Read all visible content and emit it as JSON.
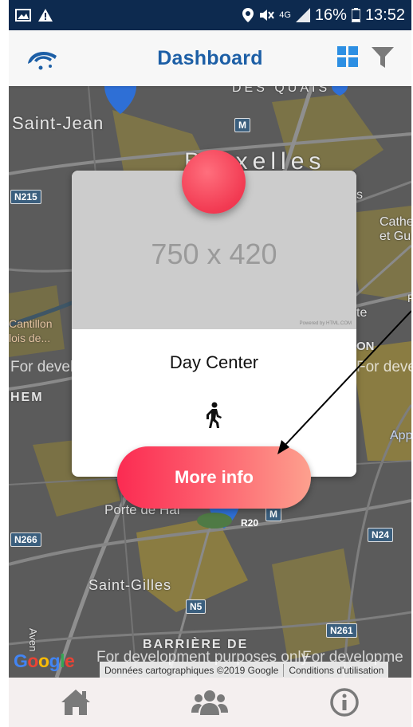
{
  "status_bar": {
    "network": "4G",
    "battery": "16%",
    "time": "13:52"
  },
  "header": {
    "title": "Dashboard",
    "logo_icon": "umbrella-logo-icon",
    "grid_icon": "grid-view-icon",
    "filter_icon": "filter-icon",
    "accent_color": "#1d5fa6"
  },
  "map": {
    "labels": {
      "saint_jean": "Saint-Jean",
      "bruxelles": "Bruxelles",
      "porte_de_hal": "Porte de Hal",
      "saint_gilles": "Saint-Gilles",
      "barriere_de": "BARRIÈRE DE",
      "des_quais": "DES QUAIS",
      "cantillon": "Cantillon",
      "lois_de": "lois de...",
      "hem": "HEM",
      "cathe": "Cathe",
      "et_gu": "et Gu",
      "te": "te",
      "app": "App",
      "on": "ON",
      "s": "s",
      "aven": "Aven",
      "r": "R"
    },
    "shields": [
      "N215",
      "N266",
      "N5",
      "N24",
      "N261",
      "R20",
      "M",
      "M"
    ],
    "watermark_left": "For development purposes only",
    "watermark_right": "For developme",
    "attribution_data": "Données cartographiques ©2019 Google",
    "attribution_terms": "Conditions d'utilisation",
    "google": "Google"
  },
  "card": {
    "image_placeholder": "750 x 420",
    "powered_by": "Powered by HTML.COM",
    "title": "Day Center",
    "walk_icon": "walking-person-icon",
    "dot_color": "#f23a52"
  },
  "button": {
    "label": "More info"
  },
  "bottom_nav": {
    "items": [
      {
        "icon": "home-icon"
      },
      {
        "icon": "group-icon"
      },
      {
        "icon": "info-icon"
      }
    ]
  }
}
